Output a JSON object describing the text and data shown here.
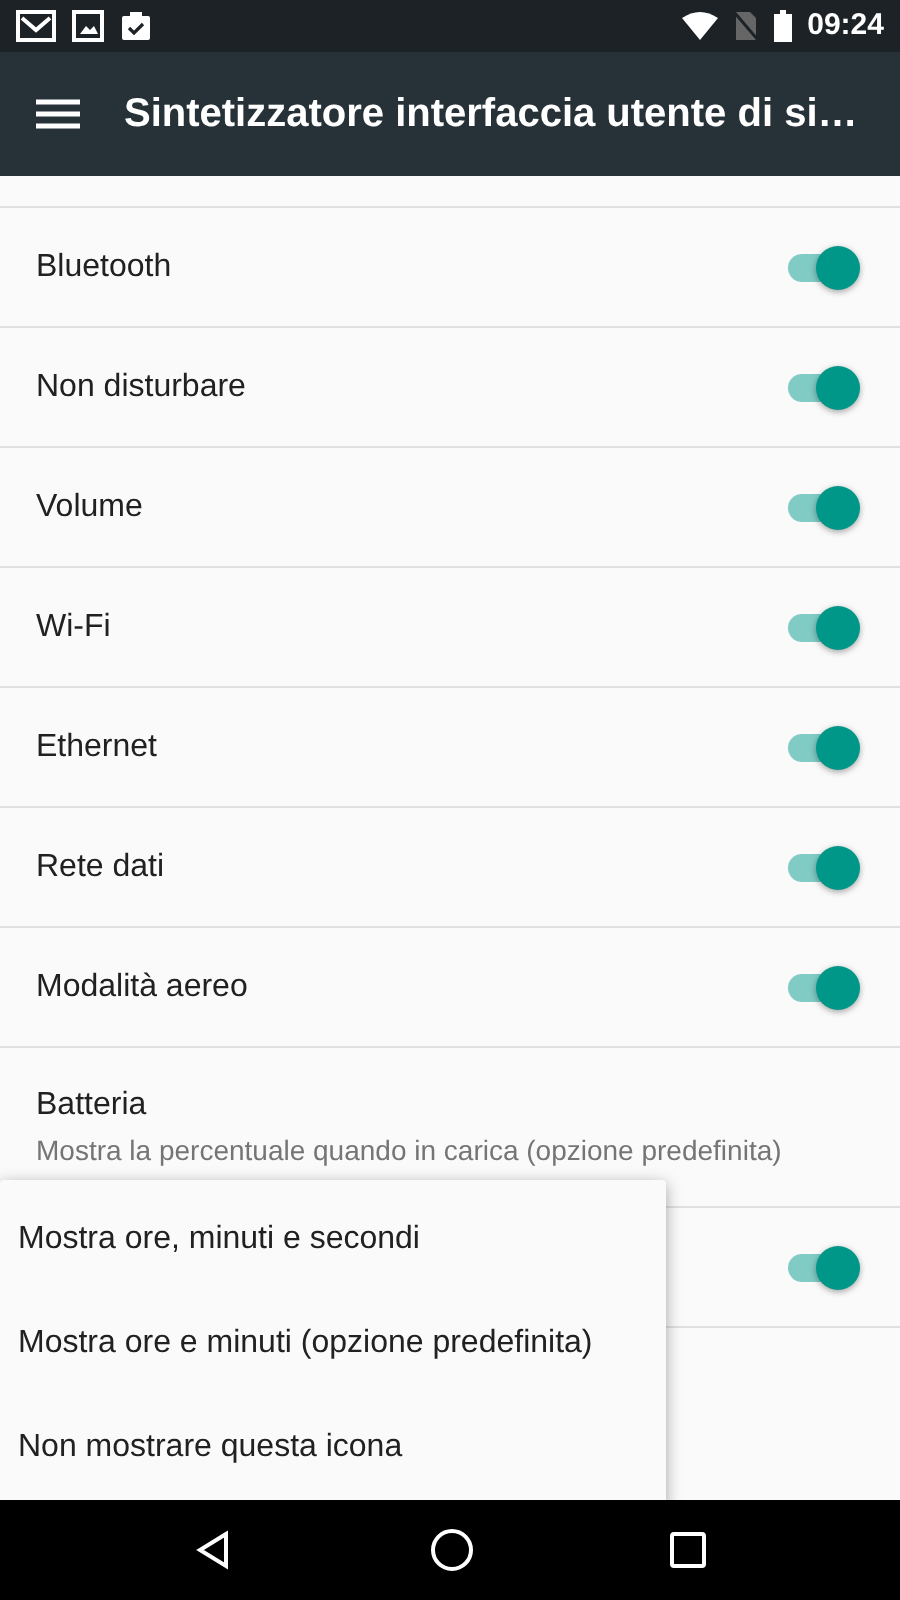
{
  "status_bar": {
    "time": "09:24"
  },
  "app_bar": {
    "title": "Sintetizzatore interfaccia utente di si…"
  },
  "rows": [
    {
      "kind": "switch",
      "label": "Bluetooth",
      "on": true
    },
    {
      "kind": "switch",
      "label": "Non disturbare",
      "on": true
    },
    {
      "kind": "switch",
      "label": "Volume",
      "on": true
    },
    {
      "kind": "switch",
      "label": "Wi-Fi",
      "on": true
    },
    {
      "kind": "switch",
      "label": "Ethernet",
      "on": true
    },
    {
      "kind": "switch",
      "label": "Rete dati",
      "on": true
    },
    {
      "kind": "switch",
      "label": "Modalità aereo",
      "on": true
    },
    {
      "kind": "summary",
      "label": "Batteria",
      "summary": "Mostra la percentuale quando in carica (opzione predefinita)"
    },
    {
      "kind": "switch",
      "on": true
    }
  ],
  "popup_menu": {
    "items": [
      {
        "label": "Mostra ore, minuti e secondi"
      },
      {
        "label": "Mostra ore e minuti (opzione predefinita)"
      },
      {
        "label": "Non mostrare questa icona"
      }
    ]
  }
}
